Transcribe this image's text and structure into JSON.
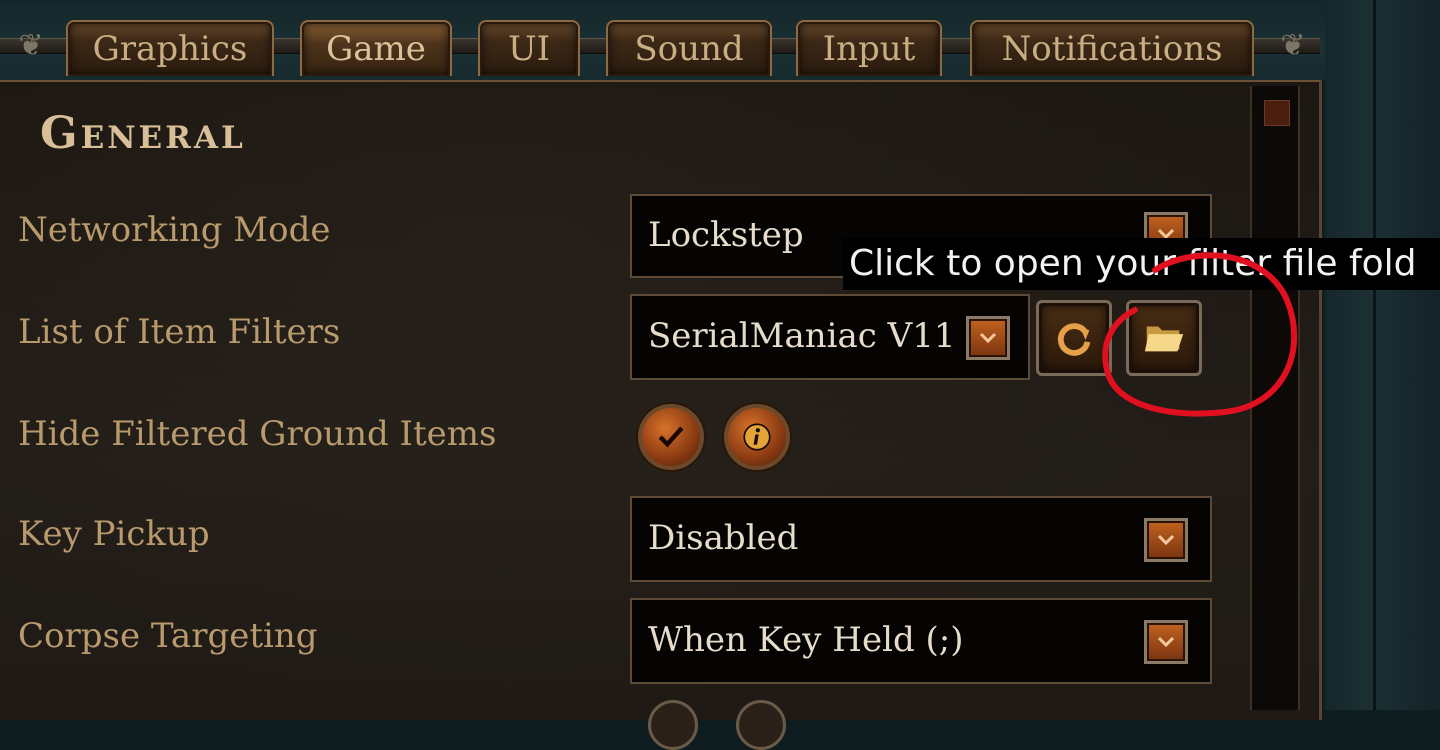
{
  "tabs": [
    {
      "label": "Graphics",
      "active": false
    },
    {
      "label": "Game",
      "active": true
    },
    {
      "label": "UI",
      "active": false
    },
    {
      "label": "Sound",
      "active": false
    },
    {
      "label": "Input",
      "active": false
    },
    {
      "label": "Notifications",
      "active": false
    }
  ],
  "section": {
    "title": "General"
  },
  "settings": {
    "networking_mode": {
      "label": "Networking Mode",
      "value": "Lockstep"
    },
    "item_filters": {
      "label": "List of Item Filters",
      "value": "SerialManiac V11"
    },
    "hide_filtered": {
      "label": "Hide Filtered Ground Items",
      "checked": true
    },
    "key_pickup": {
      "label": "Key Pickup",
      "value": "Disabled"
    },
    "corpse_targeting": {
      "label": "Corpse Targeting",
      "value": "When Key Held (;)"
    }
  },
  "tooltip": {
    "text": "Click to open your filter file fold"
  },
  "icons": {
    "dropdown": "chevron-down-icon",
    "reload": "refresh-icon",
    "folder": "folder-icon",
    "check": "checkmark-icon",
    "info": "info-icon"
  },
  "colors": {
    "label": "#b89a6c",
    "value": "#e6dccb",
    "accent_orange": "#c2621e",
    "annotation_red": "#e01020"
  }
}
